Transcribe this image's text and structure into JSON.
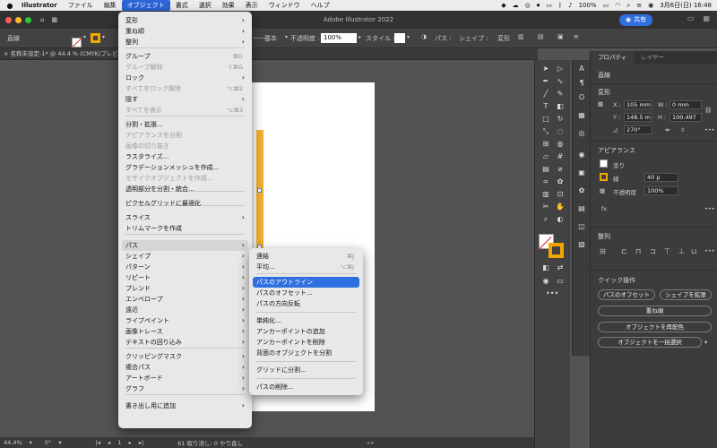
{
  "menubar": {
    "apple": "",
    "items": [
      "Illustrator",
      "ファイル",
      "編集",
      "オブジェクト",
      "書式",
      "選択",
      "効果",
      "表示",
      "ウィンドウ",
      "ヘルプ"
    ],
    "battery": "100%",
    "clock": "3月6日(日)  16:48"
  },
  "titlebar": {
    "title": "Adobe Illustrator 2022",
    "share": "共有"
  },
  "controlbar": {
    "mode": "直線",
    "stroke_style": "基本",
    "opacity_label": "不透明度 :",
    "opacity_value": "100%",
    "style_label": "スタイル :",
    "path_label": "パス :",
    "shape_label": "シェイプ :",
    "transform": "変形"
  },
  "doc_tab": "× 名称未設定-1* @ 44.4 % (CMYK/プレビュー)",
  "statusbar": {
    "zoom": "44.4%",
    "angle": "0°",
    "page": "1",
    "info": "61 取り消し: 0 やり直し"
  },
  "object_menu": {
    "items": [
      {
        "label": "変形",
        "arrow": true
      },
      {
        "label": "重ね順",
        "arrow": true
      },
      {
        "label": "整列",
        "arrow": true
      },
      {
        "label": "グループ",
        "shortcut": "⌘G"
      },
      {
        "label": "グループ解除",
        "shortcut": "⇧⌘G",
        "disabled": true
      },
      {
        "label": "ロック",
        "arrow": true
      },
      {
        "label": "すべてをロック解除",
        "shortcut": "⌥⌘2",
        "disabled": true
      },
      {
        "label": "隠す",
        "arrow": true
      },
      {
        "label": "すべてを表示",
        "shortcut": "⌥⌘3",
        "disabled": true
      },
      {
        "label": "分割・拡張..."
      },
      {
        "label": "アピアランスを分割",
        "disabled": true
      },
      {
        "label": "画像の切り抜き",
        "disabled": true
      },
      {
        "label": "ラスタライズ..."
      },
      {
        "label": "グラデーションメッシュを作成..."
      },
      {
        "label": "モザイクオブジェクトを作成...",
        "disabled": true
      },
      {
        "label": "透明部分を分割・統合..."
      },
      {
        "label": "ピクセルグリッドに最適化"
      },
      {
        "label": "スライス",
        "arrow": true
      },
      {
        "label": "トリムマークを作成"
      },
      {
        "label": "パス",
        "arrow": true,
        "highlight": true
      },
      {
        "label": "シェイプ",
        "arrow": true
      },
      {
        "label": "パターン",
        "arrow": true
      },
      {
        "label": "リピート",
        "arrow": true
      },
      {
        "label": "ブレンド",
        "arrow": true
      },
      {
        "label": "エンベロープ",
        "arrow": true
      },
      {
        "label": "遠近",
        "arrow": true
      },
      {
        "label": "ライブペイント",
        "arrow": true
      },
      {
        "label": "画像トレース",
        "arrow": true
      },
      {
        "label": "テキストの回り込み",
        "arrow": true
      },
      {
        "label": "クリッピングマスク",
        "arrow": true
      },
      {
        "label": "複合パス",
        "arrow": true
      },
      {
        "label": "アートボード",
        "arrow": true
      },
      {
        "label": "グラフ",
        "arrow": true
      },
      {
        "label": "書き出し用に追加",
        "arrow": true
      }
    ]
  },
  "path_menu": {
    "items": [
      {
        "label": "連結",
        "shortcut": "⌘J"
      },
      {
        "label": "平均...",
        "shortcut": "⌥⌘J"
      },
      {
        "label": "パスのアウトライン",
        "selected": true
      },
      {
        "label": "パスのオフセット..."
      },
      {
        "label": "パスの方向反転"
      },
      {
        "label": "単純化..."
      },
      {
        "label": "アンカーポイントの追加"
      },
      {
        "label": "アンカーポイントを削除"
      },
      {
        "label": "背面のオブジェクトを分割"
      },
      {
        "label": "グリッドに分割..."
      },
      {
        "label": "パスの削除..."
      }
    ]
  },
  "panel": {
    "tabs": [
      "プロパティ",
      "レイヤー"
    ],
    "section_line": "直線",
    "section_transform": "変形",
    "x_label": "X :",
    "x_value": "105 mm",
    "w_label": "W :",
    "w_value": "0 mm",
    "y_label": "Y :",
    "y_value": "148.5 m",
    "h_label": "H :",
    "h_value": "100.497",
    "angle": "270°",
    "section_appearance": "アピアランス",
    "fill": "塗り",
    "stroke": "線",
    "stroke_weight": "40 p",
    "opacity_label": "不透明度",
    "opacity_value": "100%",
    "fx": "fx.",
    "section_align": "整列",
    "section_quick": "クイック操作",
    "btn_offset": "パスのオフセット",
    "btn_expand": "シェイプを拡張",
    "btn_arrange": "重ね順",
    "btn_recolor": "オブジェクトを再配色",
    "btn_select_same": "オブジェクトを一括選択"
  },
  "colors": {
    "menu_highlight": "#2f6fe0",
    "shape": "#f0b030",
    "share": "#2f6fe0"
  }
}
